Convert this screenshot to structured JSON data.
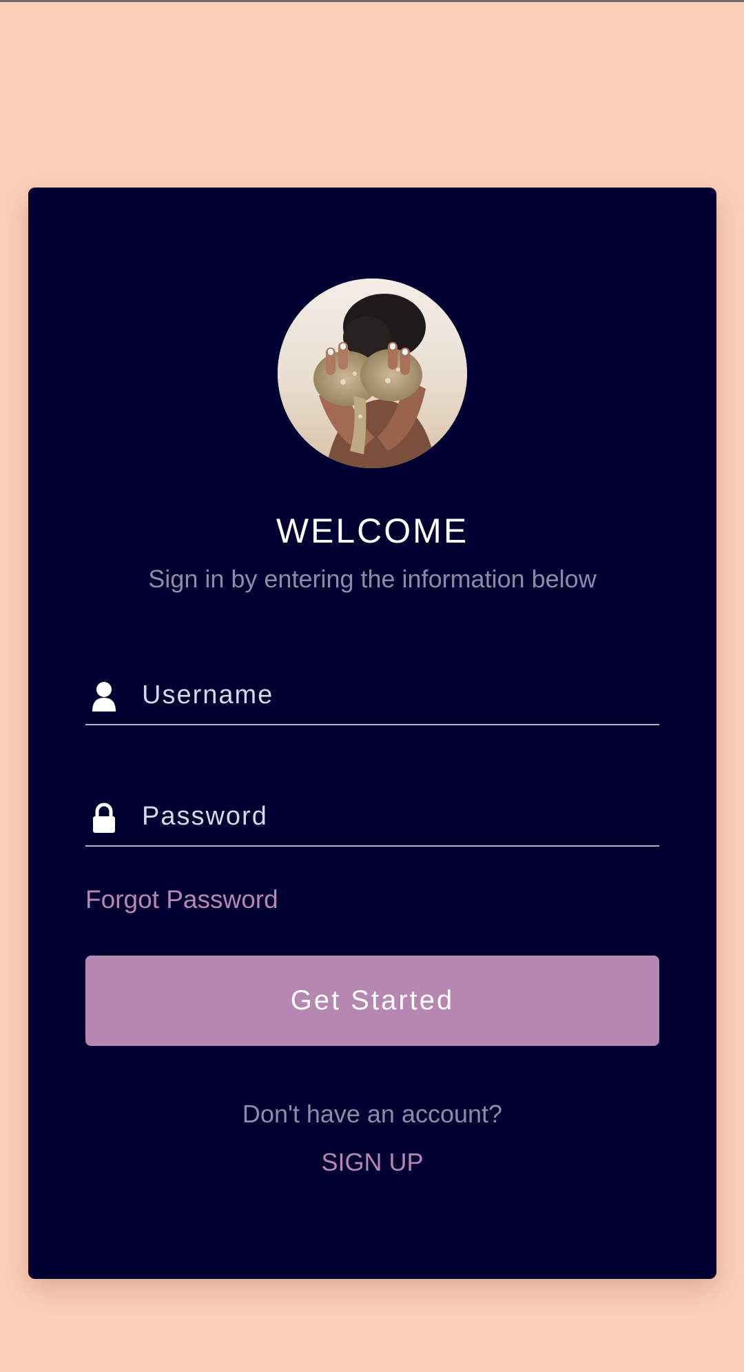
{
  "colors": {
    "page_background": "#FCD0B8",
    "card_background": "#010030",
    "accent": "#B587B1",
    "muted_text": "#8F8AA8",
    "field_text": "#D9D6E6"
  },
  "login": {
    "avatar_icon": "avatar-photo",
    "title": "WELCOME",
    "subtitle": "Sign in by entering the information below",
    "username": {
      "icon": "user-icon",
      "placeholder": "Username",
      "value": ""
    },
    "password": {
      "icon": "lock-icon",
      "placeholder": "Password",
      "value": ""
    },
    "forgot_password_label": "Forgot Password",
    "submit_label": "Get Started",
    "no_account_text": "Don't have an account?",
    "signup_label": "SIGN UP"
  }
}
